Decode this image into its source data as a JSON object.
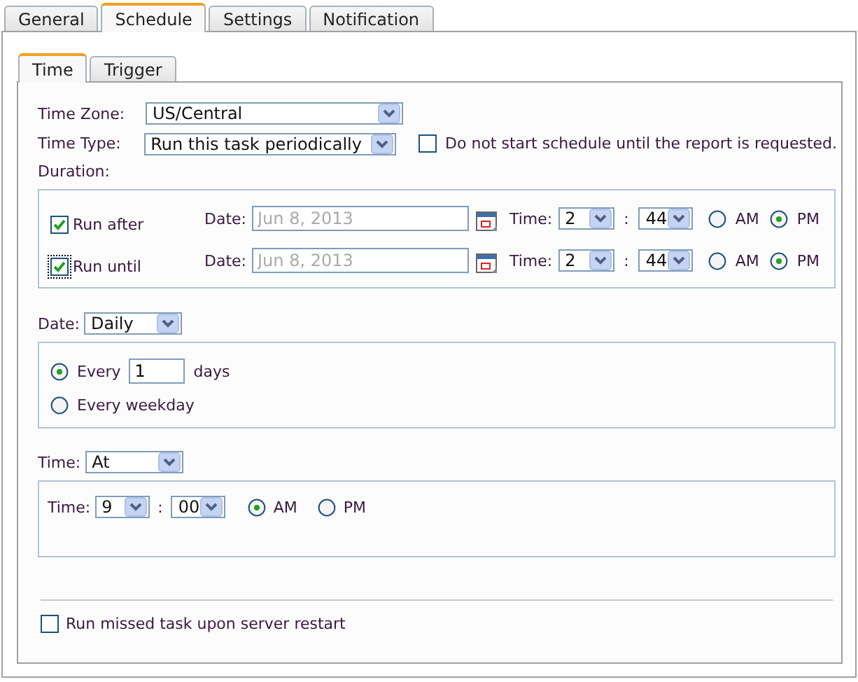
{
  "tabs": [
    {
      "label": "General",
      "selected": false
    },
    {
      "label": "Schedule",
      "selected": true
    },
    {
      "label": "Settings",
      "selected": false
    },
    {
      "label": "Notification",
      "selected": false
    }
  ],
  "subtabs": [
    {
      "label": "Time",
      "selected": true
    },
    {
      "label": "Trigger",
      "selected": false
    }
  ],
  "time_zone": {
    "label": "Time Zone:",
    "value": "US/Central"
  },
  "time_type": {
    "label": "Time Type:",
    "value": "Run this task periodically"
  },
  "defer_option": {
    "label": "Do not start schedule until the report is requested.",
    "checked": false
  },
  "duration": {
    "label": "Duration:",
    "rows": [
      {
        "label": "Run after",
        "checked": true,
        "focused": false,
        "date_label": "Date:",
        "date_value": "Jun 8, 2013",
        "time_label": "Time:",
        "hour": "2",
        "separator": ":",
        "minute": "44",
        "am": {
          "label": "AM",
          "selected": false
        },
        "pm": {
          "label": "PM",
          "selected": true
        }
      },
      {
        "label": "Run until",
        "checked": true,
        "focused": true,
        "date_label": "Date:",
        "date_value": "Jun 8, 2013",
        "time_label": "Time:",
        "hour": "2",
        "separator": ":",
        "minute": "44",
        "am": {
          "label": "AM",
          "selected": false
        },
        "pm": {
          "label": "PM",
          "selected": true
        }
      }
    ]
  },
  "date": {
    "label": "Date:",
    "value": "Daily",
    "options": [
      {
        "kind": "interval",
        "label": "Every",
        "value": "1",
        "suffix": "days",
        "selected": true
      },
      {
        "kind": "plain",
        "label": "Every weekday",
        "selected": false
      }
    ]
  },
  "time": {
    "label": "Time:",
    "value": "At",
    "time_label": "Time:",
    "hour": "9",
    "separator": ":",
    "minute": "00",
    "am": {
      "label": "AM",
      "selected": true
    },
    "pm": {
      "label": "PM",
      "selected": false
    }
  },
  "restart_option": {
    "label": "Run missed task upon server restart",
    "checked": false
  }
}
